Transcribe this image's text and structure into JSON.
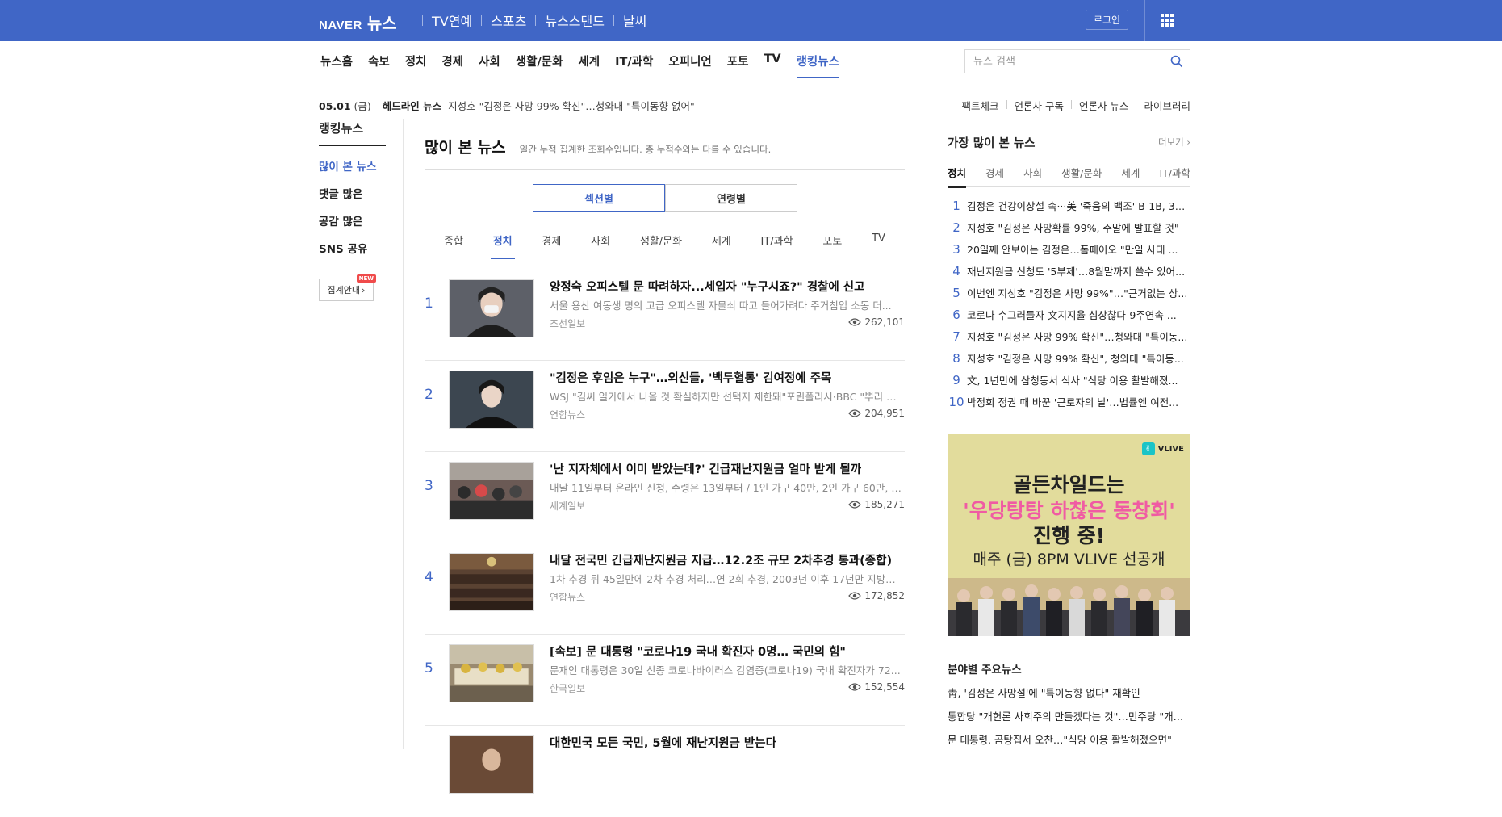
{
  "header": {
    "logo": "NAVER",
    "service": "뉴스",
    "nav": [
      "TV연예",
      "스포츠",
      "뉴스스탠드",
      "날씨"
    ],
    "login_label": "로그인",
    "apps_icon": "grid-icon",
    "bg_color": "#4066c6"
  },
  "subnav": {
    "items": [
      "뉴스홈",
      "속보",
      "정치",
      "경제",
      "사회",
      "생활/문화",
      "세계",
      "IT/과학",
      "오피니언",
      "포토",
      "TV",
      "랭킹뉴스"
    ],
    "active": "랭킹뉴스",
    "search_placeholder": "뉴스 검색",
    "search_icon": "search-icon"
  },
  "infobar": {
    "date": "05.01",
    "weekday": "(금)",
    "label": "헤드라인 뉴스",
    "headline": "지성호 \"김정은 사망 99% 확신\"…청와대 \"특이동향 없어\"",
    "links": [
      "팩트체크",
      "언론사 구독",
      "언론사 뉴스",
      "라이브러리"
    ]
  },
  "sidebar": {
    "title": "랭킹뉴스",
    "links": [
      "많이 본 뉴스",
      "댓글 많은",
      "공감 많은",
      "SNS 공유"
    ],
    "active": "많이 본 뉴스",
    "agg_label": "집계안내",
    "new_badge": "NEW"
  },
  "main": {
    "title": "많이 본 뉴스",
    "desc": "일간 누적 집계한 조회수입니다. 총 누적수와는 다를 수 있습니다.",
    "toggle": [
      "섹션별",
      "연령별"
    ],
    "toggle_active": "섹션별",
    "tabs": [
      "종합",
      "정치",
      "경제",
      "사회",
      "생활/문화",
      "세계",
      "IT/과학",
      "포토",
      "TV"
    ],
    "active_tab": "정치",
    "articles": [
      {
        "rank": "1",
        "title": "양정숙 오피스텔 문 따려하자...세입자 \"누구시죠?\" 경찰에 신고",
        "summary": "서울 용산 여동생 명의 고급 오피스텔 자물쇠 따고 들어가려다 주거침입 소동 더...",
        "press": "조선일보",
        "views": "262,101"
      },
      {
        "rank": "2",
        "title": "\"김정은 후임은 누구\"…외신들, '백두혈통' 김여정에 주목",
        "summary": "WSJ \"김씨 일가에서 나올 것 확실하지만 선택지 제한돼\"포린폴리시·BBC \"뿌리 깊...",
        "press": "연합뉴스",
        "views": "204,951"
      },
      {
        "rank": "3",
        "title": "'난 지자체에서 이미 받았는데?' 긴급재난지원금 얼마 받게 될까",
        "summary": "내달 11일부터 온라인 신청, 수령은 13일부터 / 1인 가구 40만, 2인 가구 60만, 3인 ...",
        "press": "세계일보",
        "views": "185,271"
      },
      {
        "rank": "4",
        "title": "내달 전국민 긴급재난지원금 지급…12.2조 규모 2차추경 통과(종합)",
        "summary": "1차 추경 뒤 45일만에 2차 추경 처리…연 2회 추경, 2003년 이후 17년만 지방비 2.1...",
        "press": "연합뉴스",
        "views": "172,852"
      },
      {
        "rank": "5",
        "title": "[속보] 문 대통령 \"코로나19 국내 확진자 0명… 국민의 힘\"",
        "summary": "문재인 대통령은 30일 신종 코로나바이러스 감염증(코로나19) 국내 확진자가 72...",
        "press": "한국일보",
        "views": "152,554"
      },
      {
        "rank": "6",
        "title": "대한민국 모든 국민, 5월에 재난지원금 받는다",
        "summary": "",
        "press": "",
        "views": ""
      }
    ]
  },
  "right": {
    "title": "가장 많이 본 뉴스",
    "more": "더보기",
    "tabs": [
      "정치",
      "경제",
      "사회",
      "생활/문화",
      "세계",
      "IT/과학"
    ],
    "active_tab": "정치",
    "ranking": [
      "김정은 건강이상설 속···美 '죽음의 백조' B-1B, 32...",
      "지성호 \"김정은 사망확률 99%, 주말에 발표할 것\"",
      "20일째 안보이는 김정은…폼페이오 \"만일 사태 ...",
      "재난지원금 신청도 '5부제'…8월말까지 쓸수 있어...",
      "이번엔 지성호 \"김정은 사망 99%\"…\"근거없는 상...",
      "코로나 수그러들자 文지지율 심상찮다-9주연속 ...",
      "지성호 \"김정은 사망 99% 확신\"…청와대 \"특이동...",
      "지성호 \"김정은 사망 99% 확신\", 청와대 \"특이동...",
      "文, 1년만에 삼청동서 식사 \"식당 이용 활발해졌...",
      "박정희 정권 때 바꾼 '근로자의 날'…법률엔 여전..."
    ],
    "ad": {
      "brand": "VLIVE",
      "line1": "골든차일드는",
      "line2": "'우당탕탕 하찮은 동창회'",
      "line3": "진행 중!",
      "line4": "매주 (금) 8PM  VLIVE 선공개",
      "accent": "#f05ba3"
    },
    "section_title": "분야별 주요뉴스",
    "section_news": [
      "靑, '김정은 사망설'에 \"특이동향 없다\" 재확인",
      "통합당 \"개헌론 사회주의 만들겠다는 것\"…민주당 \"개헌...",
      "문 대통령, 곰탕집서 오찬…\"식당 이용 활발해졌으면\""
    ]
  }
}
